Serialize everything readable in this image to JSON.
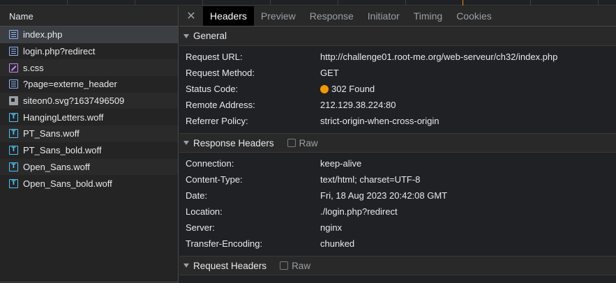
{
  "files": {
    "header": "Name",
    "items": [
      {
        "name": "index.php",
        "icon": "document-icon"
      },
      {
        "name": "login.php?redirect",
        "icon": "document-icon"
      },
      {
        "name": "s.css",
        "icon": "stylesheet-icon"
      },
      {
        "name": "?page=externe_header",
        "icon": "document-icon"
      },
      {
        "name": "siteon0.svg?1637496509",
        "icon": "image-icon"
      },
      {
        "name": "HangingLetters.woff",
        "icon": "font-icon"
      },
      {
        "name": "PT_Sans.woff",
        "icon": "font-icon"
      },
      {
        "name": "PT_Sans_bold.woff",
        "icon": "font-icon"
      },
      {
        "name": "Open_Sans.woff",
        "icon": "font-icon"
      },
      {
        "name": "Open_Sans_bold.woff",
        "icon": "font-icon"
      }
    ]
  },
  "tabs": {
    "close_glyph": "✕",
    "items": [
      "Headers",
      "Preview",
      "Response",
      "Initiator",
      "Timing",
      "Cookies"
    ],
    "active": "Headers"
  },
  "general": {
    "title": "General",
    "rows": [
      {
        "key": "Request URL:",
        "value": "http://challenge01.root-me.org/web-serveur/ch32/index.php"
      },
      {
        "key": "Request Method:",
        "value": "GET"
      },
      {
        "key": "Status Code:",
        "value": "302 Found"
      },
      {
        "key": "Remote Address:",
        "value": "212.129.38.224:80"
      },
      {
        "key": "Referrer Policy:",
        "value": "strict-origin-when-cross-origin"
      }
    ]
  },
  "response_headers": {
    "title": "Response Headers",
    "raw_label": "Raw",
    "rows": [
      {
        "key": "Connection:",
        "value": "keep-alive"
      },
      {
        "key": "Content-Type:",
        "value": "text/html; charset=UTF-8"
      },
      {
        "key": "Date:",
        "value": "Fri, 18 Aug 2023 20:42:08 GMT"
      },
      {
        "key": "Location:",
        "value": "./login.php?redirect"
      },
      {
        "key": "Server:",
        "value": "nginx"
      },
      {
        "key": "Transfer-Encoding:",
        "value": "chunked"
      }
    ]
  },
  "request_headers": {
    "title": "Request Headers",
    "raw_label": "Raw"
  },
  "colors": {
    "status_dot": "#f29900",
    "active_tab_bg": "#000000",
    "selected_row_bg": "#3b3e43"
  }
}
